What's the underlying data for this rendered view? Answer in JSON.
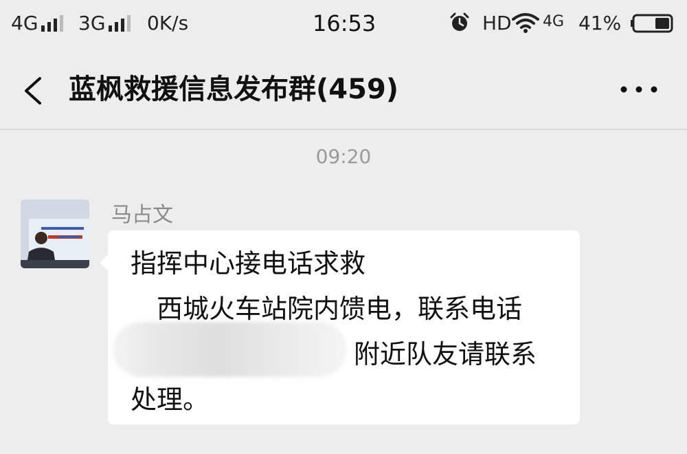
{
  "status_bar": {
    "network1": "4G",
    "network2": "3G",
    "speed": "0K/s",
    "time": "16:53",
    "hd": "HD",
    "wifi_network": "4G",
    "battery": "41%"
  },
  "header": {
    "title": "蓝枫救援信息发布群(459)"
  },
  "chat": {
    "time_divider": "09:20",
    "messages": [
      {
        "sender": "马占文",
        "lines": [
          "指挥中心接电话求救",
          "　西城火车站院内馈电，联系电话",
          "附近队友请联系",
          "处理。"
        ]
      }
    ]
  },
  "icons": {
    "back": "chevron-left-icon",
    "more": "more-icon",
    "alarm": "alarm-icon",
    "wifi": "wifi-icon",
    "battery": "battery-icon"
  },
  "colors": {
    "background": "#ededed",
    "bubble": "#ffffff",
    "secondary_text": "#9a9a9a"
  }
}
